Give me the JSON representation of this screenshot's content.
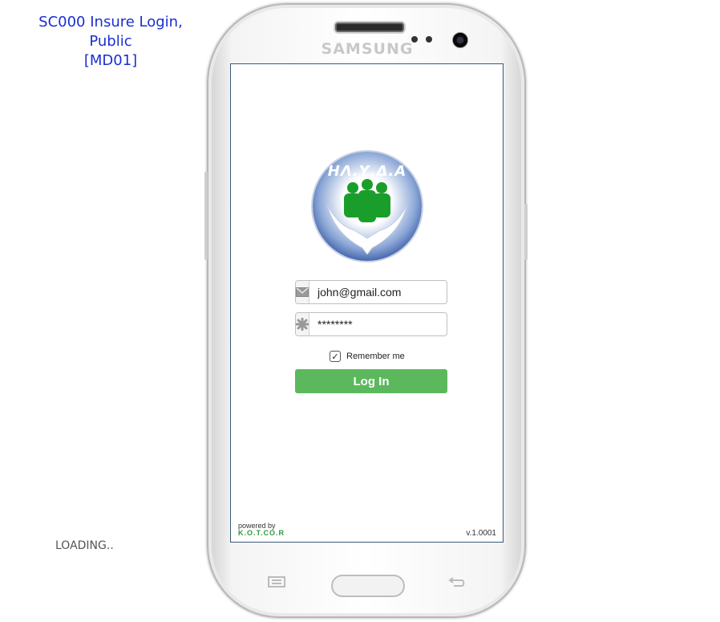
{
  "caption": {
    "line1": "SC000 Insure Login, Public",
    "line2": "[MD01]"
  },
  "status": {
    "loading": "LOADING.."
  },
  "device": {
    "brand": "SAMSUNG"
  },
  "app": {
    "logo_text": "ΗΛ.Υ.Δ.Α",
    "email_value": "john@gmail.com",
    "password_value": "********",
    "remember_label": "Remember me",
    "remember_checked": true,
    "login_label": "Log In",
    "powered_by": "powered by",
    "powered_brand": "K.O.T.CO.R",
    "version": "v.1.0001"
  },
  "colors": {
    "accent_button": "#5cb85c",
    "caption_text": "#1a2fd0",
    "logo_green": "#1a9e2b",
    "logo_blue": "#2c4d9c"
  },
  "icons": {
    "email_field": "envelope-icon",
    "password_field": "asterisk-icon",
    "checkbox": "checkmark-icon"
  }
}
